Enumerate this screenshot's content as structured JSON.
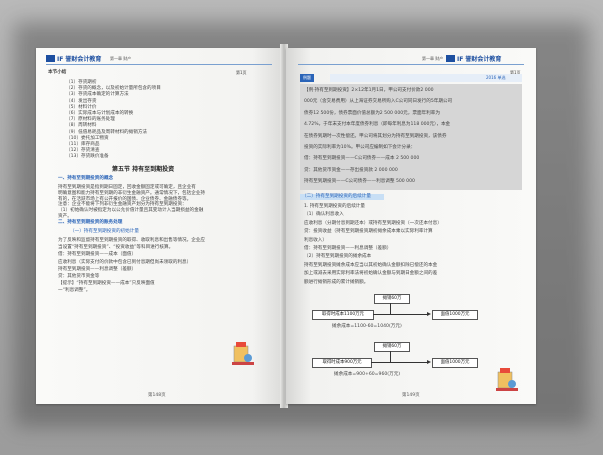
{
  "left_page": {
    "logo": "IF 誉财会计教育",
    "header_small": "第一章 财产",
    "chapter_label": "本节小结",
    "outline": [
      "（1）存货期初",
      "（2）存货的概念，以及初始计量所包含的项目",
      "（3）存货成本确定的计算方法",
      "（4）发出存货",
      "（5）材料计价",
      "（6）实际成本与计划成本的转换",
      "（7）原材料的账务处理",
      "（8）周转材料",
      "（9）低值易耗品及周转材料的摊销方法",
      "（10）委托加工物资",
      "（11）库存商品",
      "（12）存货清查",
      "（13）存货跌价准备"
    ],
    "section_title": "第五节  持有至到期投资",
    "sub1": "一、持有至到期投资的概念",
    "para1": [
      "持有至到期投资是指到期日固定，回收金额固定或可确定，且企业有",
      "明确意图和能力持有至到期的非衍生金融资产。通常情况下，包括企业持",
      "有的，在活跃市场上有公开报价的国债、企业债券、金融债券等。",
      "注意：企业不能将下列非衍生金融资产划分为持有至到期投资：",
      "（1）初始确认时被指定为以公允价值计量且其变动计入当期损益的金融",
      "资产。"
    ],
    "sub2": "二、持有至到期投资的账务处理",
    "sub2_1": "（一）持有至到期投资的初始计量",
    "para2": [
      "为了反映和监督持有至到期投资的取得、收取利息和出售等情况，企业应",
      "当设置“持有至到期投资”、“投资收益”等科目进行核算。",
      "借：持有至到期投资——成本（面值）",
      "    应收利息（实际支付的价款中包含已到付息期但尚未领取的利息）",
      "    持有至到期投资——利息调整（差额）",
      "  贷：其他货币资金等",
      "【提示】“持有至到期投资——成本”只反映面值",
      "一“利息调整”。"
    ],
    "page_number": "第148页"
  },
  "right_page": {
    "logo": "IF 誉财会计教育",
    "header_small": "第一章 财产",
    "example_tag": "例题",
    "year_tag": "2016 单选",
    "example_lines": [
      "【例·持有至到期投资】2×12年1月1日，甲公司支付价款2 000",
      "000元（含交易费用）从上海证券交易所购入C公司同日发行的5年期公司",
      "债券12 500份，债券票面价值总额为2 500 000元，票面年利率为",
      "4.72%，于年末支付本年度债券利息（即每年利息为118 000元），本金",
      "在债券到期时一次性偿还。甲公司将其划分为持有至到期投资，该债券",
      "投资的实际利率为10%。甲公司应编制如下会计分录：",
      "借：持有至到期投资——C公司债券——成本 2 500 000",
      "  贷：其他货币资金——存出投资款     2 000 000",
      "      持有至到期投资——C公司债券——利息调整     500 000"
    ],
    "sub2_2": "（二）持有至到期投资的后续计量",
    "para3": [
      "1. 持有至到期投资的后续计量",
      "（1）确认利息收入",
      "应收利息（分期付息到期还本）或持有至到期投资（一次还本付息）",
      "贷：投资收益（持有至到期投资期初摊余成本乘以实际利率计算",
      "利息收入）",
      "借：持有至到期投资——利息调整（差额）",
      "（2）持有至到期投资的摊余成本",
      "  持有至到期投资摊余成本应当以其初始确认金额扣除已偿还的本金",
      "  加上或减去采用实际利率法将初始确认金额与到期日金额之间的差",
      "  额进行摊销形成的累计摊销额。"
    ],
    "diagram1": {
      "top_box": "摊销60万",
      "left_box": "取得时成本1100万元",
      "right_box": "面值1000万元",
      "bottom_label": "摊余成本=1100-60=1040(万元)"
    },
    "diagram2": {
      "top_box": "摊销60万",
      "left_box": "取得时成本900万元",
      "right_box": "面值1000万元",
      "bottom_label": "摊余成本=900+60=960(万元)"
    },
    "page_number": "第149页"
  }
}
